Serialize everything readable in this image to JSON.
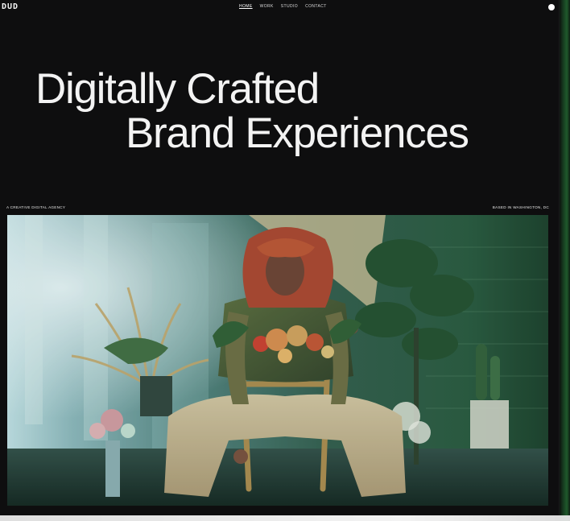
{
  "header": {
    "logo": "DUD",
    "nav": [
      {
        "label": "HOME",
        "active": true
      },
      {
        "label": "WORK",
        "active": false
      },
      {
        "label": "STUDIO",
        "active": false
      },
      {
        "label": "CONTACT",
        "active": false
      }
    ]
  },
  "hero": {
    "headline_line1": "Digitally Crafted",
    "headline_line2": "Brand Experiences",
    "tagline_left": "A CREATIVE DIGITAL AGENCY",
    "tagline_right": "BASED IN WASHINGTON, DC"
  },
  "icons": {
    "menu": "menu-dot-icon"
  },
  "colors": {
    "background": "#0e0e0f",
    "text": "#f3f3f3",
    "accent_green": "#1f5a2c"
  }
}
